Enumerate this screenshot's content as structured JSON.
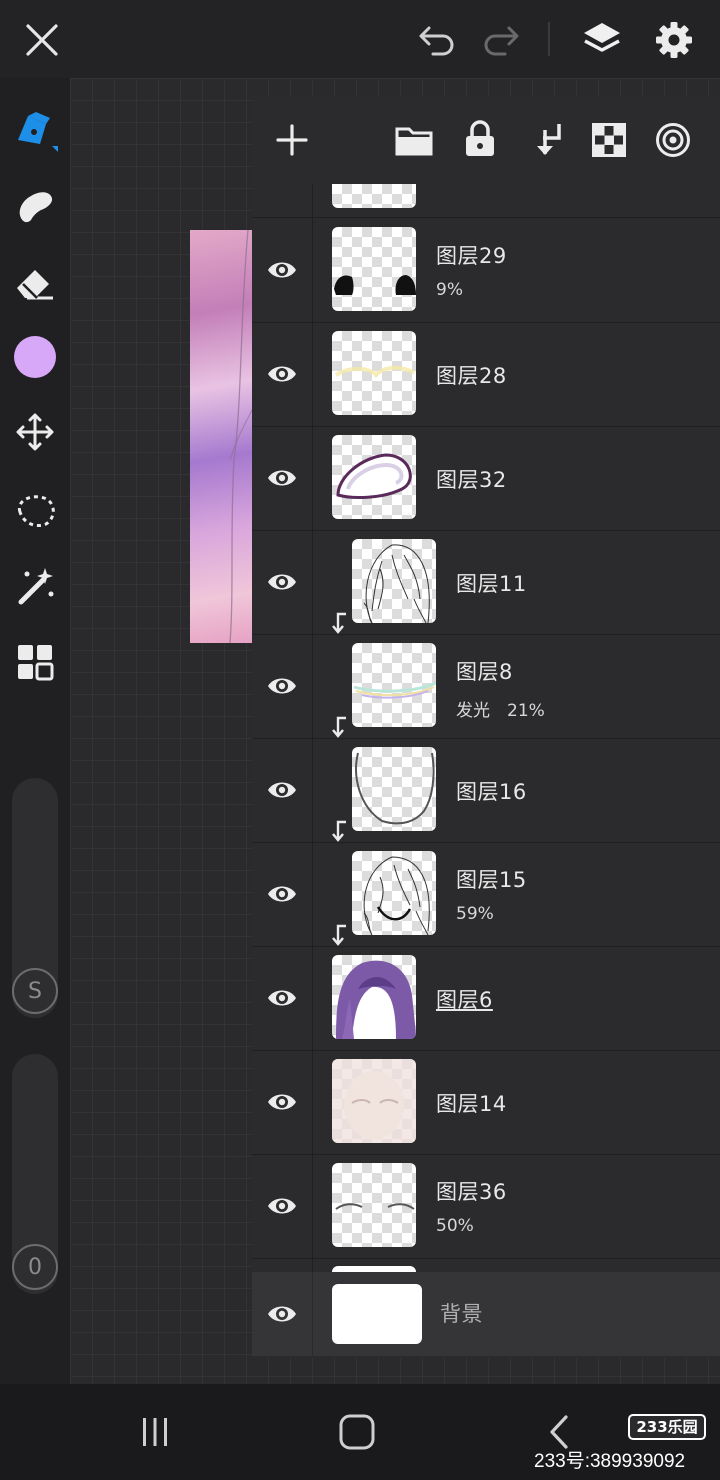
{
  "layers": [
    {
      "name": "图层29",
      "sub": "9%",
      "clip": false,
      "thumb": "eyes"
    },
    {
      "name": "图层28",
      "sub": "",
      "clip": false,
      "thumb": "glow"
    },
    {
      "name": "图层32",
      "sub": "",
      "clip": false,
      "thumb": "oval"
    },
    {
      "name": "图层11",
      "sub": "",
      "clip": true,
      "thumb": "hair"
    },
    {
      "name": "图层8",
      "sub": "发光　21%",
      "clip": true,
      "thumb": "rainbow"
    },
    {
      "name": "图层16",
      "sub": "",
      "clip": true,
      "thumb": "curve"
    },
    {
      "name": "图层15",
      "sub": "59%",
      "clip": true,
      "thumb": "hair2"
    },
    {
      "name": "图层6",
      "sub": "",
      "clip": false,
      "thumb": "purple",
      "selected": true
    },
    {
      "name": "图层14",
      "sub": "",
      "clip": false,
      "thumb": "face"
    },
    {
      "name": "图层36",
      "sub": "50%",
      "clip": false,
      "thumb": "brows"
    }
  ],
  "background_layer": {
    "name": "背景"
  },
  "left_tools": [
    "brush-icon",
    "smudge-icon",
    "eraser-icon",
    "color-swatch",
    "transform-icon",
    "lasso-icon",
    "magic-wand-icon",
    "grid-icon"
  ],
  "sliders": {
    "size_label": "S",
    "opacity_label": "0"
  },
  "watermark": {
    "logo": "233乐园",
    "text": "233号:389939092"
  },
  "colors": {
    "accent": "#1e8fe8",
    "swatch": "#d8a8f8"
  }
}
